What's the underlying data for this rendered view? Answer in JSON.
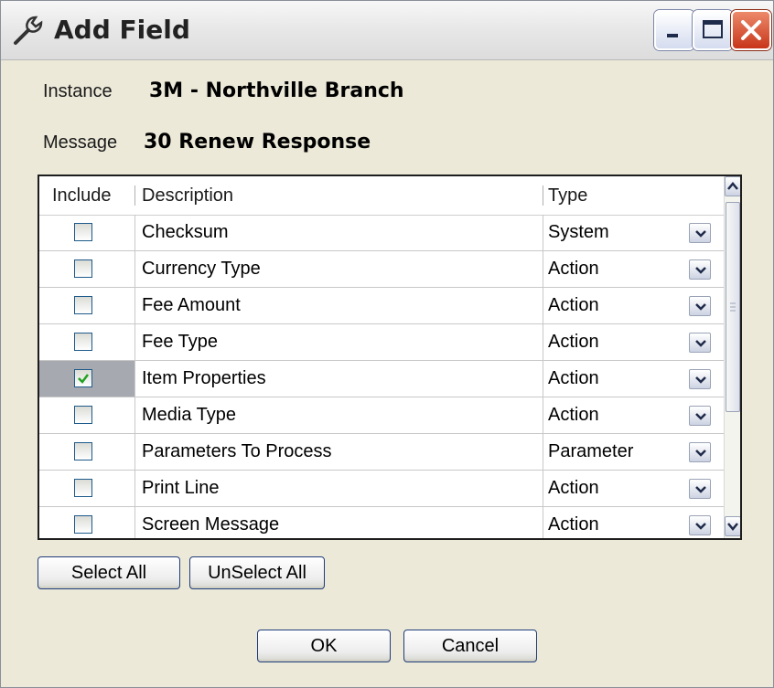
{
  "window": {
    "title": "Add Field"
  },
  "info": {
    "instance_label": "Instance",
    "instance_value": "3M - Northville Branch",
    "message_label": "Message",
    "message_value": "30 Renew Response"
  },
  "table": {
    "headers": {
      "include": "Include",
      "description": "Description",
      "type": "Type"
    },
    "rows": [
      {
        "checked": false,
        "description": "Checksum",
        "type": "System"
      },
      {
        "checked": false,
        "description": "Currency Type",
        "type": "Action"
      },
      {
        "checked": false,
        "description": "Fee Amount",
        "type": "Action"
      },
      {
        "checked": false,
        "description": "Fee Type",
        "type": "Action"
      },
      {
        "checked": true,
        "description": "Item Properties",
        "type": "Action"
      },
      {
        "checked": false,
        "description": "Media Type",
        "type": "Action"
      },
      {
        "checked": false,
        "description": "Parameters To Process",
        "type": "Parameter"
      },
      {
        "checked": false,
        "description": "Print Line",
        "type": "Action"
      },
      {
        "checked": false,
        "description": "Screen Message",
        "type": "Action"
      }
    ]
  },
  "buttons": {
    "select_all": "Select All",
    "unselect_all": "UnSelect All",
    "ok": "OK",
    "cancel": "Cancel"
  },
  "icons": {
    "title": "wrench-icon",
    "minimize": "minimize-icon",
    "maximize": "maximize-icon",
    "close": "close-icon",
    "checkmark": "checkmark-icon",
    "dropdown": "chevron-down-icon"
  },
  "colors": {
    "check_green": "#21a121",
    "close_red": "#c8351a",
    "selected_cell": "#a7a9b0"
  }
}
